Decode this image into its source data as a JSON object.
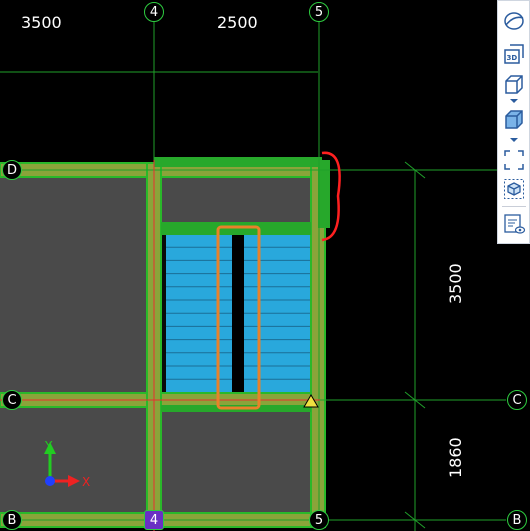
{
  "dimensions": {
    "top_left": "3500",
    "top_mid": "2500",
    "right_upper": "3500",
    "right_lower": "1860"
  },
  "axes": {
    "grid4_top": "4",
    "grid5_top": "5",
    "gridD_left": "D",
    "gridC_left": "C",
    "gridC_right": "C",
    "gridB_left": "B",
    "grid4_bottom": "4",
    "grid5_bottom": "5",
    "gridB_right": "B"
  },
  "ucs": {
    "y_label": "Y",
    "x_label": "X"
  },
  "toolbar": {
    "icons": [
      "orbit-icon",
      "view-3d-icon",
      "cube-wireframe-icon",
      "cube-shaded-icon",
      "section-box-icon",
      "isolate-icon",
      "properties-eye-icon"
    ]
  },
  "colors": {
    "background": "#000000",
    "grid_line": "#1fa02a",
    "wall": "#8aa43a",
    "slab": "#4a4a4a",
    "stair": "#29a8dc",
    "highlight_orange": "#e8822a",
    "callout_red": "#ff2020"
  }
}
